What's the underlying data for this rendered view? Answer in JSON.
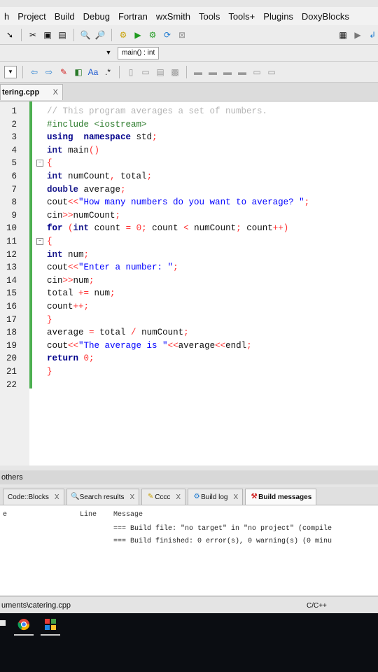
{
  "menu": [
    "h",
    "Project",
    "Build",
    "Debug",
    "Fortran",
    "wxSmith",
    "Tools",
    "Tools+",
    "Plugins",
    "DoxyBlocks"
  ],
  "toolbar": {
    "function_combo": "main() : int"
  },
  "editor_tab": {
    "title": "tering.cpp",
    "close": "X"
  },
  "code_lines": [
    {
      "n": "1",
      "html": "<span class='cm'>// This program averages a set of numbers.</span>"
    },
    {
      "n": "2",
      "html": "<span class='pp'>#include &lt;iostream&gt;</span>"
    },
    {
      "n": "3",
      "html": "<span class='kw'>using</span>  <span class='kw'>namespace</span> std<span class='op'>;</span>"
    },
    {
      "n": "4",
      "html": "<span class='ty'>int</span> main<span class='op'>()</span>"
    },
    {
      "n": "5",
      "html": "<span class='op'>{</span>"
    },
    {
      "n": "6",
      "html": "<span class='ty'>int</span> numCount<span class='op'>,</span> total<span class='op'>;</span>"
    },
    {
      "n": "7",
      "html": "<span class='ty'>double</span> average<span class='op'>;</span>"
    },
    {
      "n": "8",
      "html": "cout<span class='op'>&lt;&lt;</span><span class='str'>\"How many numbers do you want to average? \"</span><span class='op'>;</span>"
    },
    {
      "n": "9",
      "html": "cin<span class='op'>&gt;&gt;</span>numCount<span class='op'>;</span>"
    },
    {
      "n": "10",
      "html": "<span class='kw'>for</span> <span class='op'>(</span><span class='ty'>int</span> count <span class='op'>=</span> <span class='num'>0</span><span class='op'>;</span> count <span class='op'>&lt;</span> numCount<span class='op'>;</span> count<span class='op'>++)</span>"
    },
    {
      "n": "11",
      "html": "<span class='op'>{</span>"
    },
    {
      "n": "12",
      "html": "<span class='ty'>int</span> num<span class='op'>;</span>"
    },
    {
      "n": "13",
      "html": "cout<span class='op'>&lt;&lt;</span><span class='str'>\"Enter a number: \"</span><span class='op'>;</span>"
    },
    {
      "n": "14",
      "html": "cin<span class='op'>&gt;&gt;</span>num<span class='op'>;</span>"
    },
    {
      "n": "15",
      "html": "total <span class='op'>+=</span> num<span class='op'>;</span>"
    },
    {
      "n": "16",
      "html": "count<span class='op'>++;</span>"
    },
    {
      "n": "17",
      "html": "<span class='op'>}</span>"
    },
    {
      "n": "18",
      "html": "average <span class='op'>=</span> total <span class='op'>/</span> numCount<span class='op'>;</span>"
    },
    {
      "n": "19",
      "html": "cout<span class='op'>&lt;&lt;</span><span class='str'>\"The average is \"</span><span class='op'>&lt;&lt;</span>average<span class='op'>&lt;&lt;</span>endl<span class='op'>;</span>"
    },
    {
      "n": "20",
      "html": "<span class='kw'>return</span> <span class='num'>0</span><span class='op'>;</span>"
    },
    {
      "n": "21",
      "html": "<span class='op'>}</span>"
    },
    {
      "n": "22",
      "html": ""
    }
  ],
  "panel": {
    "title": "others",
    "tabs": [
      {
        "label": "Code::Blocks",
        "close": "X",
        "active": false
      },
      {
        "label": "Search results",
        "close": "X",
        "active": false
      },
      {
        "label": "Cccc",
        "close": "X",
        "active": false
      },
      {
        "label": "Build log",
        "close": "X",
        "active": false
      },
      {
        "label": "Build messages",
        "close": "",
        "active": true
      }
    ],
    "col_file": "e",
    "col_line": "Line",
    "col_message": "Message",
    "messages": [
      "=== Build file: \"no target\" in \"no project\" (compile",
      "=== Build finished: 0 error(s), 0 warning(s) (0 minu"
    ]
  },
  "status": {
    "path": "uments\\catering.cpp",
    "language": "C/C++"
  }
}
